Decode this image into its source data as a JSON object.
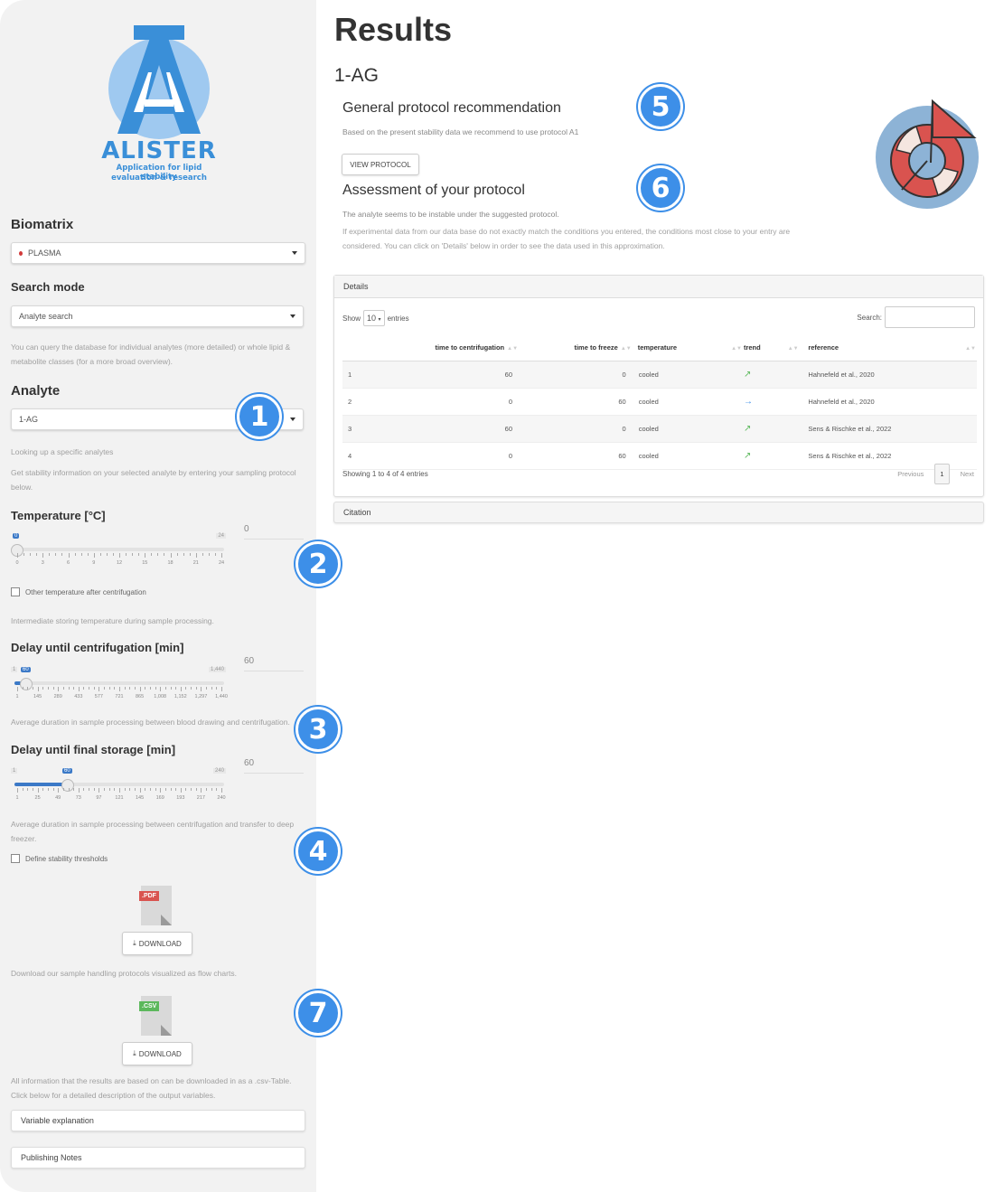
{
  "logo": {
    "name": "ALISTER",
    "tagline_line1": "Application for lipid stability",
    "tagline_line2": "evaluation & research",
    "color": "#3a8fd8"
  },
  "sidebar": {
    "biomatrix": {
      "label": "Biomatrix",
      "value": "PLASMA"
    },
    "search_mode": {
      "label": "Search mode",
      "value": "Analyte search",
      "help": "You can query the database for individual analytes (more detailed) or whole lipid & metabolite classes (for a more broad overview)."
    },
    "analyte": {
      "label": "Analyte",
      "value": "1-AG",
      "help1": "Looking up a specific analytes",
      "help2": "Get stability information on your selected analyte by entering your sampling protocol below."
    },
    "temperature": {
      "label": "Temperature [°C]",
      "value": 0,
      "min": 0,
      "max": 24,
      "min_label": "0",
      "max_label": "24",
      "input_value": "0",
      "ticks": [
        "0",
        "3",
        "6",
        "9",
        "12",
        "15",
        "18",
        "21",
        "24"
      ],
      "checkbox_label": "Other temperature after centrifugation",
      "help": "Intermediate storing temperature during sample processing."
    },
    "delay_centrifugation": {
      "label": "Delay until centrifugation [min]",
      "value": 60,
      "min": 1,
      "max": 1440,
      "min_label": "1",
      "value_label": "60",
      "max_label": "1,440",
      "input_value": "60",
      "ticks": [
        "1",
        "145",
        "289",
        "433",
        "577",
        "721",
        "865",
        "1,008",
        "1,152",
        "1,297",
        "1,440"
      ],
      "help": "Average duration in sample processing between blood drawing and centrifugation."
    },
    "delay_storage": {
      "label": "Delay until final storage [min]",
      "value": 60,
      "min": 1,
      "max": 240,
      "min_label": "1",
      "value_label": "60",
      "max_label": "240",
      "input_value": "60",
      "ticks": [
        "1",
        "25",
        "49",
        "73",
        "97",
        "121",
        "145",
        "169",
        "193",
        "217",
        "240"
      ],
      "help": "Average duration in sample processing between centrifugation and transfer to deep freezer."
    },
    "thresholds_label": "Define stability thresholds",
    "pdf": {
      "tag": ".PDF",
      "button": "DOWNLOAD",
      "help": "Download our sample handling protocols visualized as flow charts."
    },
    "csv": {
      "tag": ".CSV",
      "button": "DOWNLOAD",
      "help": "All information that the results are based on can be downloaded in as a .csv-Table. Click below for a detailed description of the output variables."
    },
    "variable_explanation": "Variable explanation",
    "publishing_notes": "Publishing Notes"
  },
  "markers": [
    "1",
    "2",
    "3",
    "4",
    "5",
    "6",
    "7"
  ],
  "main": {
    "title": "Results",
    "analyte": "1-AG",
    "recommendation": {
      "heading": "General protocol recommendation",
      "text": "Based on the present stability data we recommend to use protocol A1",
      "button": "VIEW PROTOCOL"
    },
    "assessment": {
      "heading": "Assessment of your protocol",
      "text1": "The analyte seems to be instable under the suggested protocol.",
      "text2": "If experimental data from our data base do not exactly match the conditions you entered, the conditions most close to your entry are considered. You can click on 'Details' below in order to see the data used in this approximation."
    },
    "details": {
      "title": "Details",
      "show_label": "Show",
      "entries_value": "10",
      "entries_label": "entries",
      "search_label": "Search:",
      "columns": [
        "",
        "time to centrifugation",
        "time to freeze",
        "temperature",
        "trend",
        "reference"
      ],
      "rows": [
        {
          "n": "1",
          "tc": "60",
          "tf": "0",
          "temp": "cooled",
          "trend": "up",
          "ref": "Hahnefeld et al., 2020"
        },
        {
          "n": "2",
          "tc": "0",
          "tf": "60",
          "temp": "cooled",
          "trend": "flat",
          "ref": "Hahnefeld et al., 2020"
        },
        {
          "n": "3",
          "tc": "60",
          "tf": "0",
          "temp": "cooled",
          "trend": "up",
          "ref": "Sens & Rischke et al., 2022"
        },
        {
          "n": "4",
          "tc": "0",
          "tf": "60",
          "temp": "cooled",
          "trend": "up",
          "ref": "Sens & Rischke et al., 2022"
        }
      ],
      "info": "Showing 1 to 4 of 4 entries",
      "prev": "Previous",
      "page": "1",
      "next": "Next"
    },
    "citation": "Citation"
  },
  "colors": {
    "accent": "#3d8fe8",
    "slider": "#3b79c7",
    "trend_up": "#5cb85c",
    "trend_flat": "#3d8fe8",
    "lifebuoy_bg": "#8db3d6",
    "lifebuoy_red": "#d9534f"
  }
}
